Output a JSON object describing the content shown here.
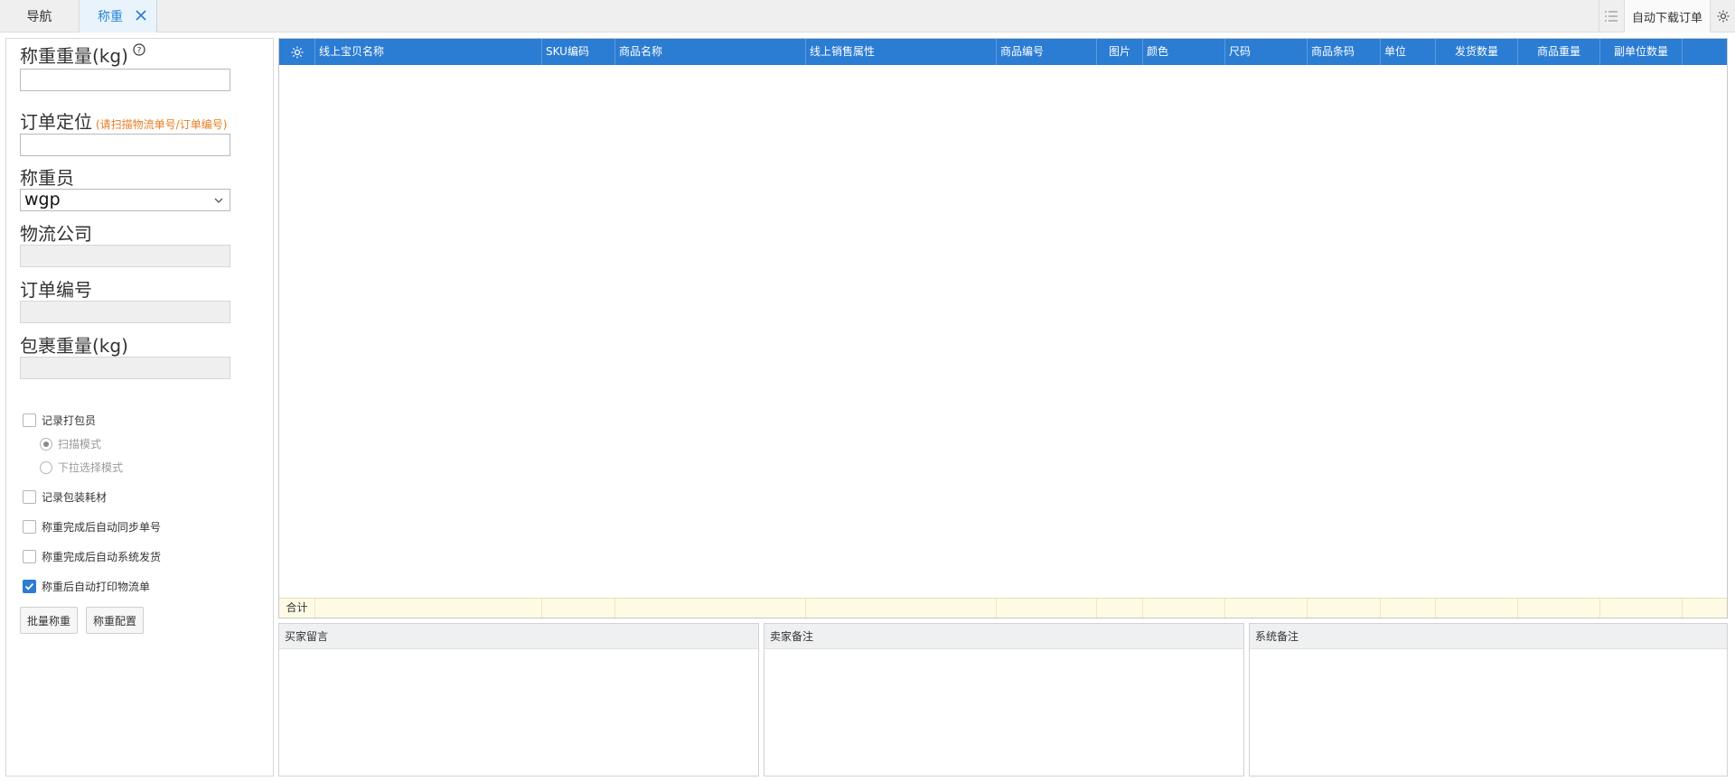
{
  "tabs": {
    "nav_label": "导航",
    "weigh_label": "称重"
  },
  "topbar": {
    "auto_download_label": "自动下载订单"
  },
  "form": {
    "weight_label": "称重重量(kg)",
    "order_locate_label": "订单定位",
    "order_locate_hint": "(请扫描物流单号/订单编号)",
    "weigher_label": "称重员",
    "weigher_value": "wgp",
    "logistics_label": "物流公司",
    "order_no_label": "订单编号",
    "package_weight_label": "包裹重量(kg)"
  },
  "options": {
    "record_packer": "记录打包员",
    "scan_mode": "扫描模式",
    "dropdown_mode": "下拉选择模式",
    "record_material": "记录包装耗材",
    "auto_sync": "称重完成后自动同步单号",
    "auto_ship": "称重完成后自动系统发货",
    "auto_print": "称重后自动打印物流单"
  },
  "buttons": {
    "batch_weigh": "批量称重",
    "weigh_config": "称重配置"
  },
  "grid": {
    "columns": [
      "线上宝贝名称",
      "SKU编码",
      "商品名称",
      "线上销售属性",
      "商品编号",
      "图片",
      "颜色",
      "尺码",
      "商品条码",
      "单位",
      "发货数量",
      "商品重量",
      "副单位数量"
    ],
    "total_label": "合计"
  },
  "panels": {
    "buyer_msg": "买家留言",
    "seller_note": "卖家备注",
    "system_note": "系统备注"
  },
  "colors": {
    "accent": "#2b7cd3",
    "hint": "#e67e22",
    "footer_bg": "#fdfbe3"
  }
}
